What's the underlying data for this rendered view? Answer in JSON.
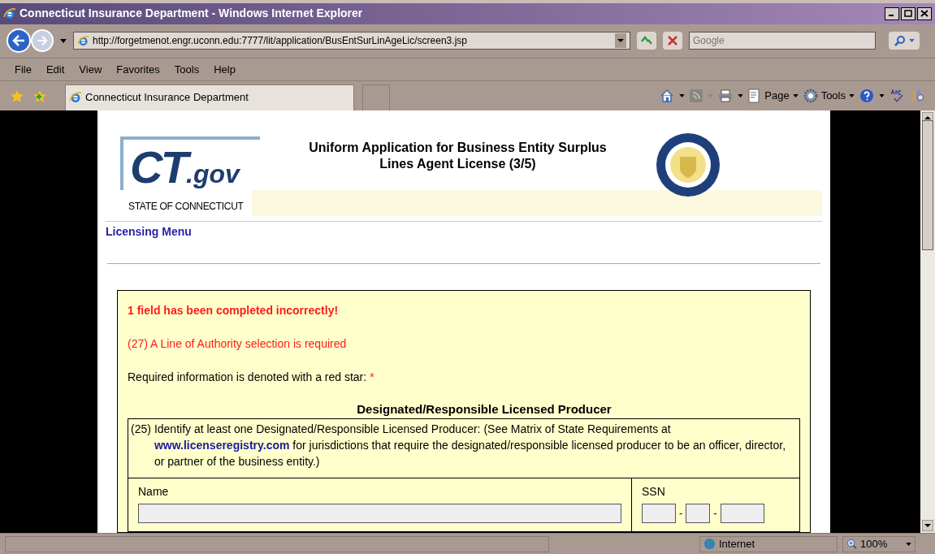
{
  "window": {
    "title": "Connecticut Insurance Department - Windows Internet Explorer"
  },
  "address_bar": {
    "url": "http://forgetmenot.engr.uconn.edu:7777/lit/application/BusEntSurLinAgeLic/screen3.jsp",
    "search_placeholder": "Google"
  },
  "menu": [
    "File",
    "Edit",
    "View",
    "Favorites",
    "Tools",
    "Help"
  ],
  "tabs": [
    {
      "label": "Connecticut Insurance Department",
      "selected": true
    }
  ],
  "command_bar": [
    "Page",
    "Tools"
  ],
  "page": {
    "logo": {
      "text": "CT",
      "suffix": ".gov",
      "tagline": "STATE OF CONNECTICUT"
    },
    "heading": [
      "Uniform Application for Business Entity Surplus",
      "Lines Agent License (3/5)"
    ],
    "menu_link": "Licensing Menu",
    "form": {
      "error_title": "1 field has been completed incorrectly!",
      "errors": [
        "(27) A Line of Authority selection is required"
      ],
      "required_note": "Required information is denoted with a red star:",
      "required_mark": "*",
      "section_title": "Designated/Responsible Licensed Producer",
      "instruction": {
        "number": "(25)",
        "before": "Identify at least one Designated/Responsible Licensed Producer: (See Matrix of State Requirements at",
        "link": "www.licenseregistry.com",
        "after": "for jurisdictions that require the designated/responsible licensed producer to be an officer, director, or partner of the business entity.)"
      },
      "name_label": "Name",
      "ssn_label": "SSN",
      "ssn_separators": [
        "-",
        "-"
      ]
    }
  },
  "status_bar": {
    "zone": "Internet",
    "zoom": "100%"
  }
}
